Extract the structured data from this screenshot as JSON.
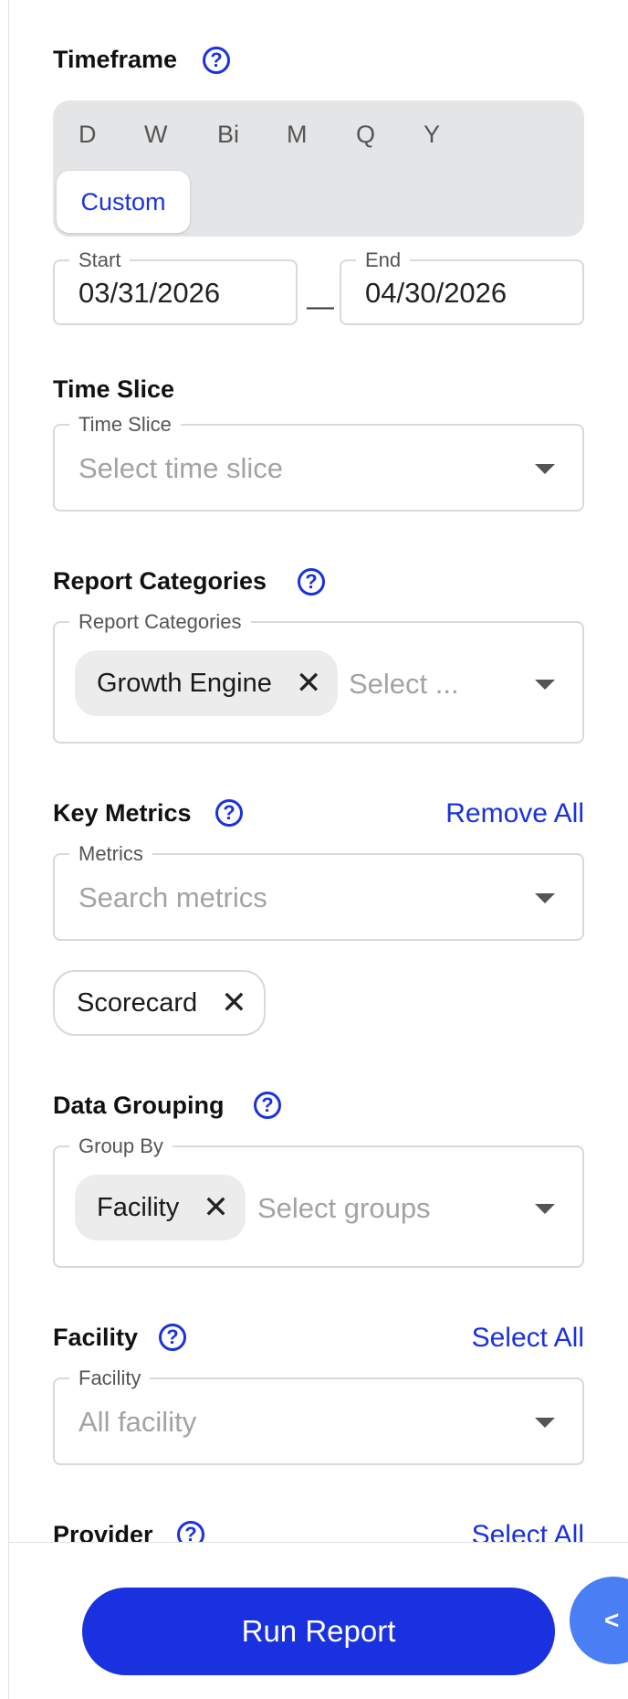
{
  "timeframe": {
    "title": "Timeframe",
    "options": [
      "D",
      "W",
      "Bi",
      "M",
      "Q",
      "Y"
    ],
    "selected": "Custom",
    "start_label": "Start",
    "start_value": "03/31/2026",
    "separator": "—",
    "end_label": "End",
    "end_value": "04/30/2026"
  },
  "time_slice": {
    "title": "Time Slice",
    "field_label": "Time Slice",
    "placeholder": "Select time slice"
  },
  "report_categories": {
    "title": "Report Categories",
    "field_label": "Report Categories",
    "chips": [
      "Growth Engine"
    ],
    "placeholder": "Select ..."
  },
  "key_metrics": {
    "title": "Key Metrics",
    "action": "Remove All",
    "field_label": "Metrics",
    "placeholder": "Search metrics",
    "chips": [
      "Scorecard"
    ]
  },
  "data_grouping": {
    "title": "Data Grouping",
    "field_label": "Group By",
    "chips": [
      "Facility"
    ],
    "placeholder": "Select groups"
  },
  "facility": {
    "title": "Facility",
    "action": "Select All",
    "field_label": "Facility",
    "placeholder": "All facility"
  },
  "provider": {
    "title": "Provider",
    "action": "Select All"
  },
  "footer": {
    "run_label": "Run Report",
    "collapse_glyph": "<"
  },
  "help_glyph": "?",
  "remove_glyph": "✕",
  "colors": {
    "accent": "#1a31e0",
    "fab": "#4a7ef5",
    "segment_bg": "#e4e5e6"
  }
}
